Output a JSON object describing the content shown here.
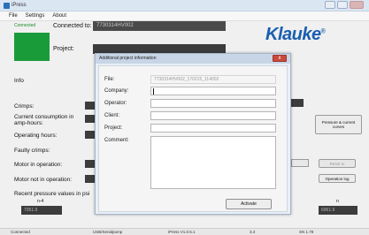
{
  "window": {
    "title": "iPress"
  },
  "menu": [
    "File",
    "Settings",
    "About"
  ],
  "connection": {
    "status": "Connected",
    "connected_to_label": "Connected to:",
    "connected_to_value": "7730314HV002",
    "project_label": "Project:"
  },
  "logo": {
    "brand": "Klauke",
    "mark": "®"
  },
  "left_panel": {
    "info_label": "Info",
    "crimps_label": "Crimps:",
    "current_consumption_label": "Current consumption in amp-hours:",
    "operating_hours_label": "Operating hours:",
    "faulty_crimps_label": "Faulty crimps:",
    "motor_in_operation_label": "Motor in operation:",
    "motor_not_in_operation_label": "Motor not in operation:",
    "recent_pressure_label": "Recent pressure values in psi",
    "recent_pressure_index": "n-4",
    "recent_pressure_first_value": "7051.9",
    "recent_pressure_last_index": "n",
    "recent_pressure_last_value": "6961.9"
  },
  "right_panel": {
    "pressure_button": "Pressure & current curves",
    "reset_button": "Reset to",
    "operation_log_button": "Operation log"
  },
  "dialog": {
    "title": "Additional project information",
    "close_symbol": "x",
    "fields": [
      {
        "label": "File:",
        "value": "7730314HV002_170215_114002"
      },
      {
        "label": "Company:",
        "value": ""
      },
      {
        "label": "Operator:",
        "value": ""
      },
      {
        "label": "Client:",
        "value": ""
      },
      {
        "label": "Project:",
        "value": ""
      },
      {
        "label": "Comment:",
        "value": ""
      }
    ],
    "activate_button": "Activate"
  },
  "statusbar": {
    "left": "Connected",
    "mid1": "USB/Serialpump",
    "mid2": "iPress V1.0.5.1",
    "mid3": "3.4",
    "right": "SN 1.78"
  },
  "colors": {
    "green_status": "#1a9b3a",
    "brand_blue": "#1a5eb0",
    "dark_field": "#3c3c3c"
  }
}
